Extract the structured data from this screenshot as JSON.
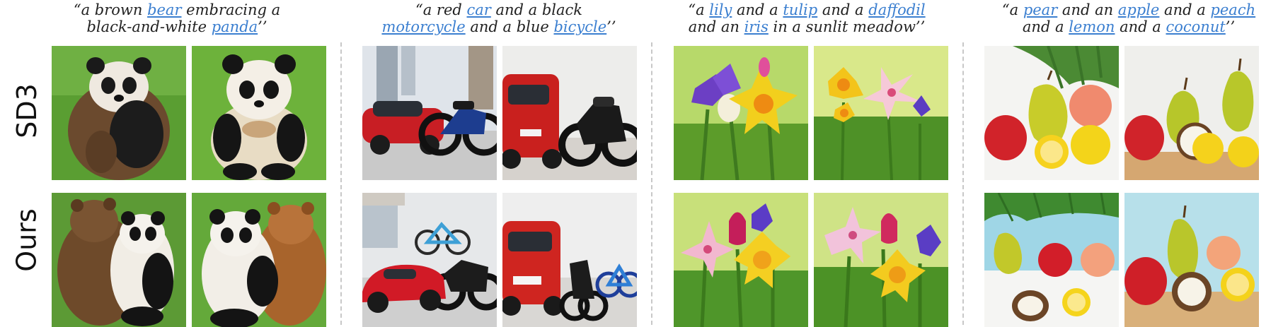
{
  "rows": [
    {
      "label": "SD3"
    },
    {
      "label": "Ours"
    }
  ],
  "prompts": [
    {
      "line1": [
        {
          "t": "“a brown ",
          "h": false
        },
        {
          "t": "bear",
          "h": true
        },
        {
          "t": " embracing a",
          "h": false
        }
      ],
      "line2": [
        {
          "t": "black-and-white ",
          "h": false
        },
        {
          "t": "panda",
          "h": true
        },
        {
          "t": "’’",
          "h": false
        }
      ]
    },
    {
      "line1": [
        {
          "t": "“a red ",
          "h": false
        },
        {
          "t": "car",
          "h": true
        },
        {
          "t": " and a black",
          "h": false
        }
      ],
      "line2": [
        {
          "t": "motorcycle",
          "h": true
        },
        {
          "t": " and a blue ",
          "h": false
        },
        {
          "t": "bicycle",
          "h": true
        },
        {
          "t": "’’",
          "h": false
        }
      ]
    },
    {
      "line1": [
        {
          "t": "“a ",
          "h": false
        },
        {
          "t": "lily",
          "h": true
        },
        {
          "t": " and a ",
          "h": false
        },
        {
          "t": "tulip",
          "h": true
        },
        {
          "t": " and a ",
          "h": false
        },
        {
          "t": "daffodil",
          "h": true
        }
      ],
      "line2": [
        {
          "t": "and an ",
          "h": false
        },
        {
          "t": "iris",
          "h": true
        },
        {
          "t": " in a sunlit meadow’’",
          "h": false
        }
      ]
    },
    {
      "line1": [
        {
          "t": "“a ",
          "h": false
        },
        {
          "t": "pear",
          "h": true
        },
        {
          "t": " and an ",
          "h": false
        },
        {
          "t": "apple",
          "h": true
        },
        {
          "t": " and a ",
          "h": false
        },
        {
          "t": "peach",
          "h": true
        }
      ],
      "line2": [
        {
          "t": "and a ",
          "h": false
        },
        {
          "t": "lemon",
          "h": true
        },
        {
          "t": " and a ",
          "h": false
        },
        {
          "t": "coconut",
          "h": true
        },
        {
          "t": "’’",
          "h": false
        }
      ]
    }
  ],
  "colors": {
    "highlight": "#3b7fd0",
    "grass": "#5a9e32",
    "divider": "#c8c8c8"
  }
}
